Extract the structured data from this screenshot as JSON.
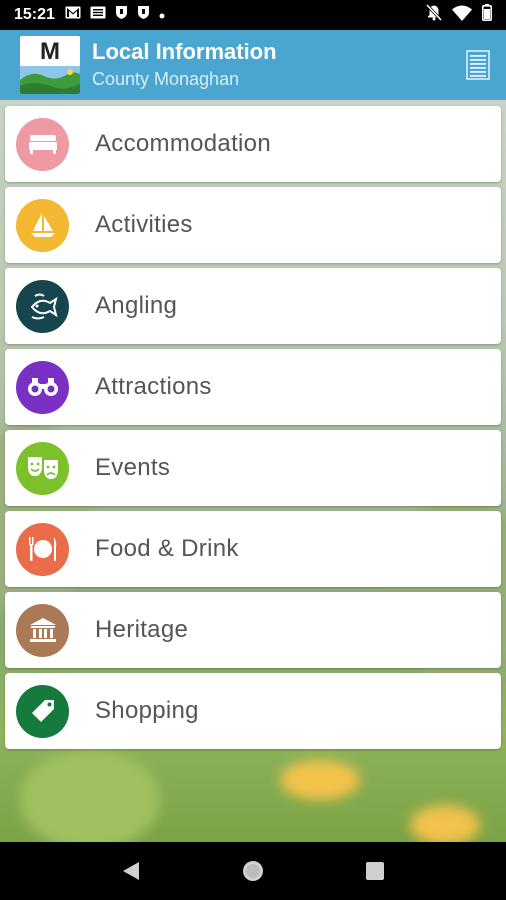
{
  "status_bar": {
    "time": "15:21",
    "left_icons": [
      "gmail-icon",
      "voicemail-icon",
      "shield-icon",
      "shield-icon",
      "dot-icon"
    ],
    "right_icons": [
      "notifications-off-icon",
      "wifi-icon",
      "battery-icon"
    ]
  },
  "app_bar": {
    "logo_letter": "M",
    "title": "Local Information",
    "subtitle": "County Monaghan",
    "menu_icon": "list-icon",
    "color": "#4aa6d0"
  },
  "menu": [
    {
      "label": "Accommodation",
      "icon": "bed-icon",
      "color": "#ef9aa3"
    },
    {
      "label": "Activities",
      "icon": "sailboat-icon",
      "color": "#f4b731"
    },
    {
      "label": "Angling",
      "icon": "fish-icon",
      "color": "#16454e"
    },
    {
      "label": "Attractions",
      "icon": "binoculars-icon",
      "color": "#7a2fc5"
    },
    {
      "label": "Events",
      "icon": "theatre-masks-icon",
      "color": "#7cc12c"
    },
    {
      "label": "Food & Drink",
      "icon": "cutlery-icon",
      "color": "#ea6c4b"
    },
    {
      "label": "Heritage",
      "icon": "museum-icon",
      "color": "#a97a55"
    },
    {
      "label": "Shopping",
      "icon": "tag-icon",
      "color": "#157a3d"
    }
  ],
  "nav_bar": {
    "buttons": [
      "back-icon",
      "home-icon",
      "recents-icon"
    ]
  }
}
